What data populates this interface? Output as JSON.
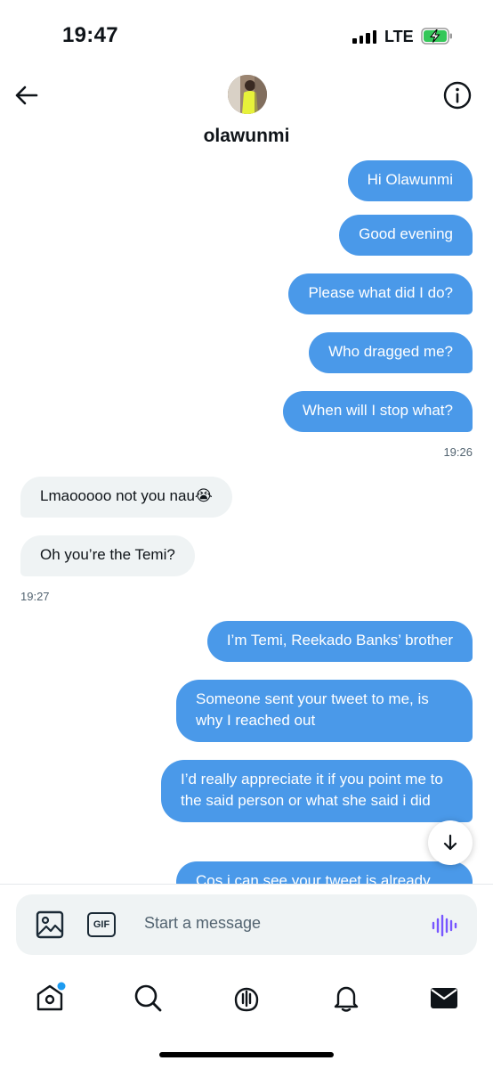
{
  "status": {
    "time": "19:47",
    "network": "LTE",
    "signal_bars": 4,
    "battery_charging": true
  },
  "header": {
    "contact_name": "olawunmi",
    "back_icon": "arrow-left-icon",
    "info_icon": "info-circle-icon"
  },
  "messages": [
    {
      "dir": "out",
      "text": "Hi Olawunmi"
    },
    {
      "dir": "out",
      "text": "Good evening"
    },
    {
      "dir": "out",
      "text": "Please what did I do?"
    },
    {
      "dir": "out",
      "text": "Who dragged me?"
    },
    {
      "dir": "out",
      "text": "When will I stop what?"
    },
    {
      "dir": "in",
      "text": "Lmaooooo not you nau😭"
    },
    {
      "dir": "in",
      "text": "Oh you’re the Temi?"
    },
    {
      "dir": "out",
      "text": "I’m Temi, Reekado Banks’ brother"
    },
    {
      "dir": "out",
      "text": "Someone sent your tweet to me, is why I reached out"
    },
    {
      "dir": "out",
      "text": "I’d really appreciate it if you point me to the said person or what she said i did"
    },
    {
      "dir": "out",
      "text": "Cos i can see your tweet is already"
    }
  ],
  "timestamps": {
    "out_group_1": "19:26",
    "in_group_1": "19:27"
  },
  "composer": {
    "placeholder": "Start a message",
    "gif_label": "GIF"
  },
  "tabs": [
    {
      "name": "home",
      "icon": "home-icon",
      "has_notification_dot": true
    },
    {
      "name": "search",
      "icon": "search-icon"
    },
    {
      "name": "spaces",
      "icon": "spaces-icon"
    },
    {
      "name": "notifications",
      "icon": "bell-icon"
    },
    {
      "name": "messages",
      "icon": "mail-icon",
      "active": true
    }
  ],
  "colors": {
    "outgoing_bubble": "#4a99e9",
    "incoming_bubble": "#eff3f4",
    "voice_accent": "#7856ff",
    "notification_dot": "#1d9bf0",
    "battery_fill": "#34c759"
  }
}
